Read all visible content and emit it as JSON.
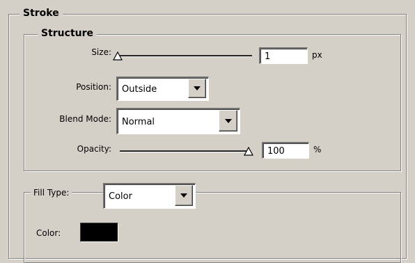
{
  "stroke": {
    "title": "Stroke",
    "structure": {
      "title": "Structure",
      "size": {
        "label": "Size:",
        "value": "1",
        "unit": "px",
        "slider_fraction": 0.0
      },
      "position": {
        "label": "Position:",
        "selected": "Outside"
      },
      "blend_mode": {
        "label": "Blend Mode:",
        "selected": "Normal"
      },
      "opacity": {
        "label": "Opacity:",
        "value": "100",
        "unit": "%",
        "slider_fraction": 1.0
      }
    },
    "fill": {
      "label": "Fill Type:",
      "selected": "Color",
      "color_label": "Color:",
      "color_value": "#000000"
    }
  }
}
